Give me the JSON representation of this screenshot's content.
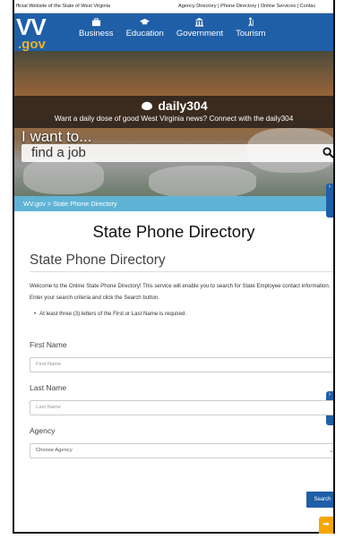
{
  "topbar": {
    "official": "fficial Website of the State of West Virginia",
    "links": "Agency Directory | Phone Directory | Online Services | Contac"
  },
  "header": {
    "logo_main": "VV",
    "logo_sub": ".gov",
    "nav": [
      {
        "label": "Business",
        "icon": "briefcase-icon"
      },
      {
        "label": "Education",
        "icon": "graduation-cap-icon"
      },
      {
        "label": "Government",
        "icon": "capitol-building-icon"
      },
      {
        "label": "Tourism",
        "icon": "hiker-icon"
      }
    ]
  },
  "hero": {
    "brand": "daily304",
    "tagline": "Want a daily dose of good West Virginia news? Connect with the daily304",
    "prompt": "I want to...",
    "search_value": "find a job"
  },
  "breadcrumb": "WV.gov > State Phone Directory",
  "main": {
    "page_title": "State Phone Directory",
    "section_title": "State Phone Directory",
    "intro": "Welcome to the Online State Phone Directory! This service will enable you to search for State Employee contact information. Enter your search criteria and click the Search button.",
    "bullet": "At least three (3) letters of the First or Last Name is required.",
    "first_name_label": "First Name",
    "first_name_placeholder": "First Name",
    "last_name_label": "Last Name",
    "last_name_placeholder": "Last Name",
    "agency_label": "Agency",
    "agency_selected": "Choose Agency",
    "search_button": "Search"
  },
  "colors": {
    "header_blue": "#1f5fa8",
    "breadcrumb_blue": "#5fb4d6",
    "logo_gold": "#f0b323",
    "fab_orange": "#f7a600"
  }
}
